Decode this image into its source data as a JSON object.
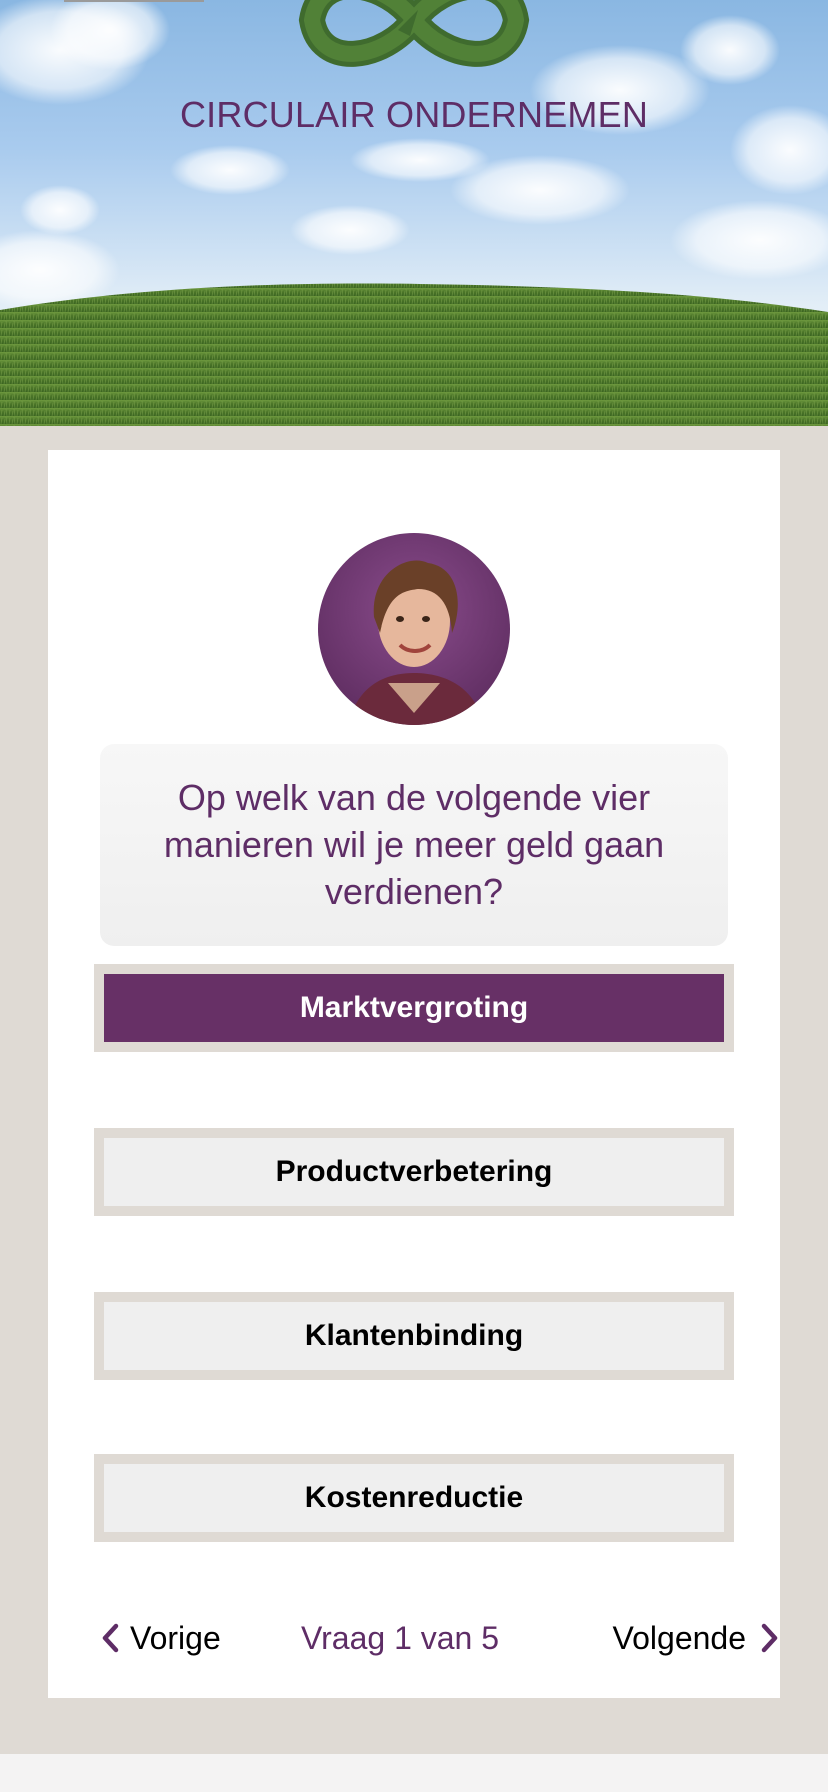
{
  "header": {
    "brand_title": "CIRCULAIR ONDERNEMEN"
  },
  "quiz": {
    "question": "Op welk van de volgende vier manieren wil je meer geld gaan verdienen?",
    "options": [
      {
        "label": "Marktvergroting",
        "selected": true
      },
      {
        "label": "Productverbetering",
        "selected": false
      },
      {
        "label": "Klantenbinding",
        "selected": false
      },
      {
        "label": "Kostenreductie",
        "selected": false
      }
    ]
  },
  "nav": {
    "prev_label": "Vorige",
    "progress": "Vraag 1 van 5",
    "next_label": "Volgende"
  },
  "colors": {
    "brand_purple": "#5e2d66",
    "selected_bg": "#673066",
    "frame": "#dfdad4",
    "option_bg": "#efefef"
  },
  "icons": [
    "infinity-logo-icon",
    "chevron-left-icon",
    "chevron-right-icon"
  ]
}
